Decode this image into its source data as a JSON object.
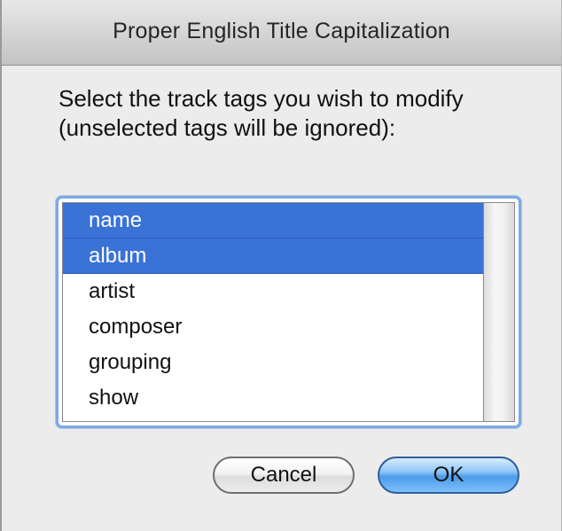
{
  "window": {
    "title": "Proper English Title Capitalization"
  },
  "dialog": {
    "prompt": "Select the track tags you wish to modify (unselected tags will be ignored):",
    "tags": [
      {
        "label": "name",
        "selected": true
      },
      {
        "label": "album",
        "selected": true
      },
      {
        "label": "artist",
        "selected": false
      },
      {
        "label": "composer",
        "selected": false
      },
      {
        "label": "grouping",
        "selected": false
      },
      {
        "label": "show",
        "selected": false
      }
    ]
  },
  "buttons": {
    "cancel_label": "Cancel",
    "ok_label": "OK"
  },
  "colors": {
    "selection": "#3a72d6",
    "focus_ring": "#7ea9e1",
    "default_button": "#4c9be9"
  }
}
